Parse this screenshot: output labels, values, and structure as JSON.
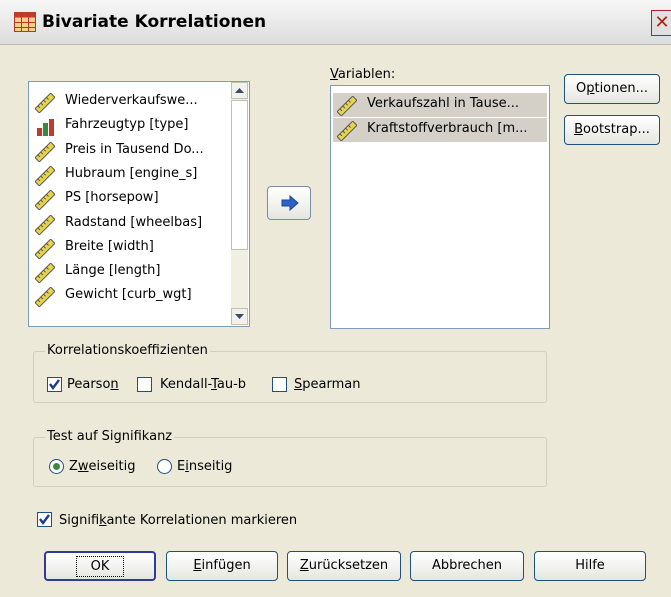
{
  "window": {
    "title": "Bivariate Korrelationen",
    "close": "✕"
  },
  "source_list": {
    "items": [
      {
        "label": "Wiederverkaufswe...",
        "type": "scale"
      },
      {
        "label": "Fahrzeugtyp [type]",
        "type": "nominal"
      },
      {
        "label": "Preis in Tausend Do...",
        "type": "scale"
      },
      {
        "label": "Hubraum [engine_s]",
        "type": "scale"
      },
      {
        "label": "PS [horsepow]",
        "type": "scale"
      },
      {
        "label": "Radstand [wheelbas]",
        "type": "scale"
      },
      {
        "label": "Breite [width]",
        "type": "scale"
      },
      {
        "label": "Länge [length]",
        "type": "scale"
      },
      {
        "label": "Gewicht [curb_wgt]",
        "type": "scale"
      }
    ]
  },
  "move_button": {
    "icon": "arrow-right-icon"
  },
  "target": {
    "label": "Variablen:",
    "items": [
      {
        "label": "Verkaufszahl in Tause...",
        "type": "scale"
      },
      {
        "label": "Kraftstoffverbrauch [m...",
        "type": "scale"
      }
    ]
  },
  "side_buttons": {
    "options": "Optionen...",
    "bootstrap": "Bootstrap..."
  },
  "correlation_group": {
    "title": "Korrelationskoeffizienten",
    "pearson": "Pearson",
    "pearson_checked": true,
    "kendall": "Kendall-Tau-b",
    "kendall_checked": false,
    "spearman": "Spearman",
    "spearman_checked": false
  },
  "significance_group": {
    "title": "Test auf Signifikanz",
    "two_tailed": "Zweiseitig",
    "one_tailed": "Einseitig",
    "selected": "two_tailed"
  },
  "flag_checkbox": {
    "label": "Signifikante Korrelationen markieren",
    "checked": true
  },
  "bottom_buttons": {
    "ok": "OK",
    "paste": "Einfügen",
    "reset": "Zurücksetzen",
    "cancel": "Abbrechen",
    "help": "Hilfe"
  },
  "colors": {
    "selection": "#d4d0c8",
    "border": "#7f9db9",
    "accent": "#2b64c6",
    "ruler_yellow": "#e8d44a"
  }
}
